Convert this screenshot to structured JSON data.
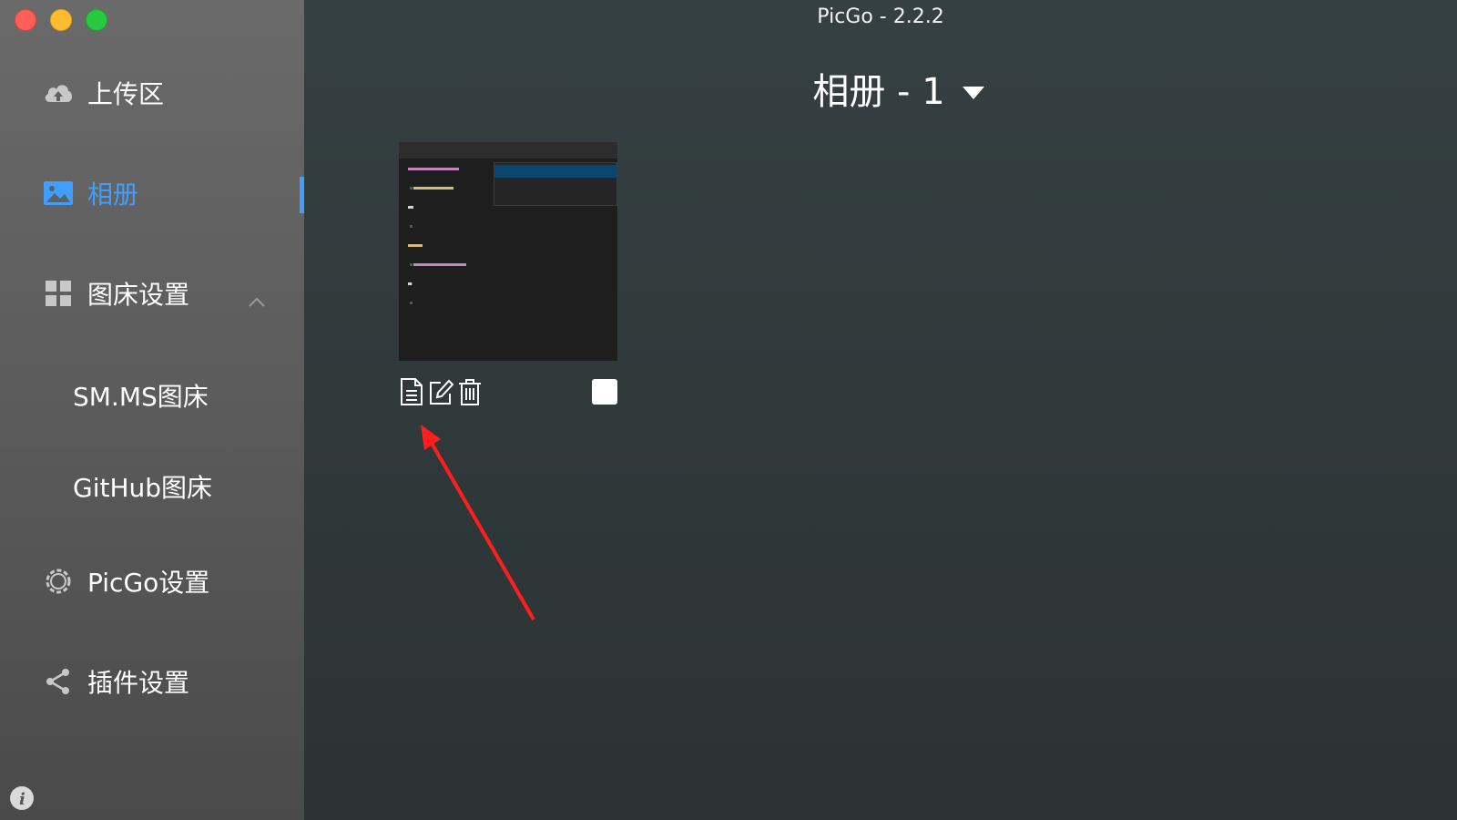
{
  "window": {
    "title": "PicGo - 2.2.2"
  },
  "sidebar": {
    "items": [
      {
        "label": "上传区",
        "icon": "cloud-upload-icon"
      },
      {
        "label": "相册",
        "icon": "image-icon",
        "active": true
      },
      {
        "label": "图床设置",
        "icon": "grid-icon",
        "expanded": true
      },
      {
        "label": "PicGo设置",
        "icon": "gear-icon"
      },
      {
        "label": "插件设置",
        "icon": "share-icon"
      }
    ],
    "subitems": [
      {
        "label": "SM.MS图床"
      },
      {
        "label": "GitHub图床"
      }
    ],
    "accent": "#409eff"
  },
  "main": {
    "album_title": "相册 - 1",
    "photos": [
      {
        "actions": [
          "copy-link-icon",
          "edit-icon",
          "delete-icon"
        ],
        "checked": false
      }
    ]
  }
}
